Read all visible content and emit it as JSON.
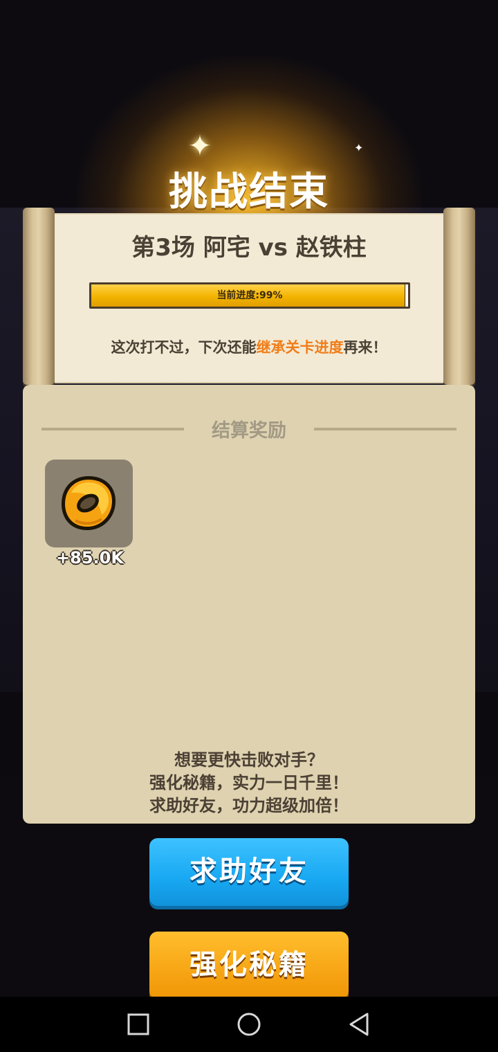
{
  "header": {
    "title": "挑战结束"
  },
  "result_scroll": {
    "match_title": "第3场 阿宅 vs 赵铁柱",
    "progress_label": "当前进度:99%",
    "progress_value": 0.99,
    "retry_prefix": "这次打不过，下次还能",
    "retry_highlight": "继承关卡进度",
    "retry_suffix": "再来！"
  },
  "rewards": {
    "section_title": "结算奖励",
    "items": [
      {
        "icon": "coin-icon",
        "amount": "+85.0K"
      }
    ]
  },
  "tips": {
    "line1": "想要更快击败对手？",
    "line2": "强化秘籍，实力一日千里！",
    "line3": "求助好友，功力超级加倍！"
  },
  "buttons": {
    "help_friend": "求助好友",
    "boost_skill": "强化秘籍"
  },
  "system_nav": {
    "recents": "square-icon",
    "home": "circle-icon",
    "back": "triangle-back-icon"
  },
  "colors": {
    "highlight": "#f07d18",
    "help_button": "#18a8f2",
    "boost_button": "#f7a514",
    "progress_fill": "#f3b400"
  }
}
